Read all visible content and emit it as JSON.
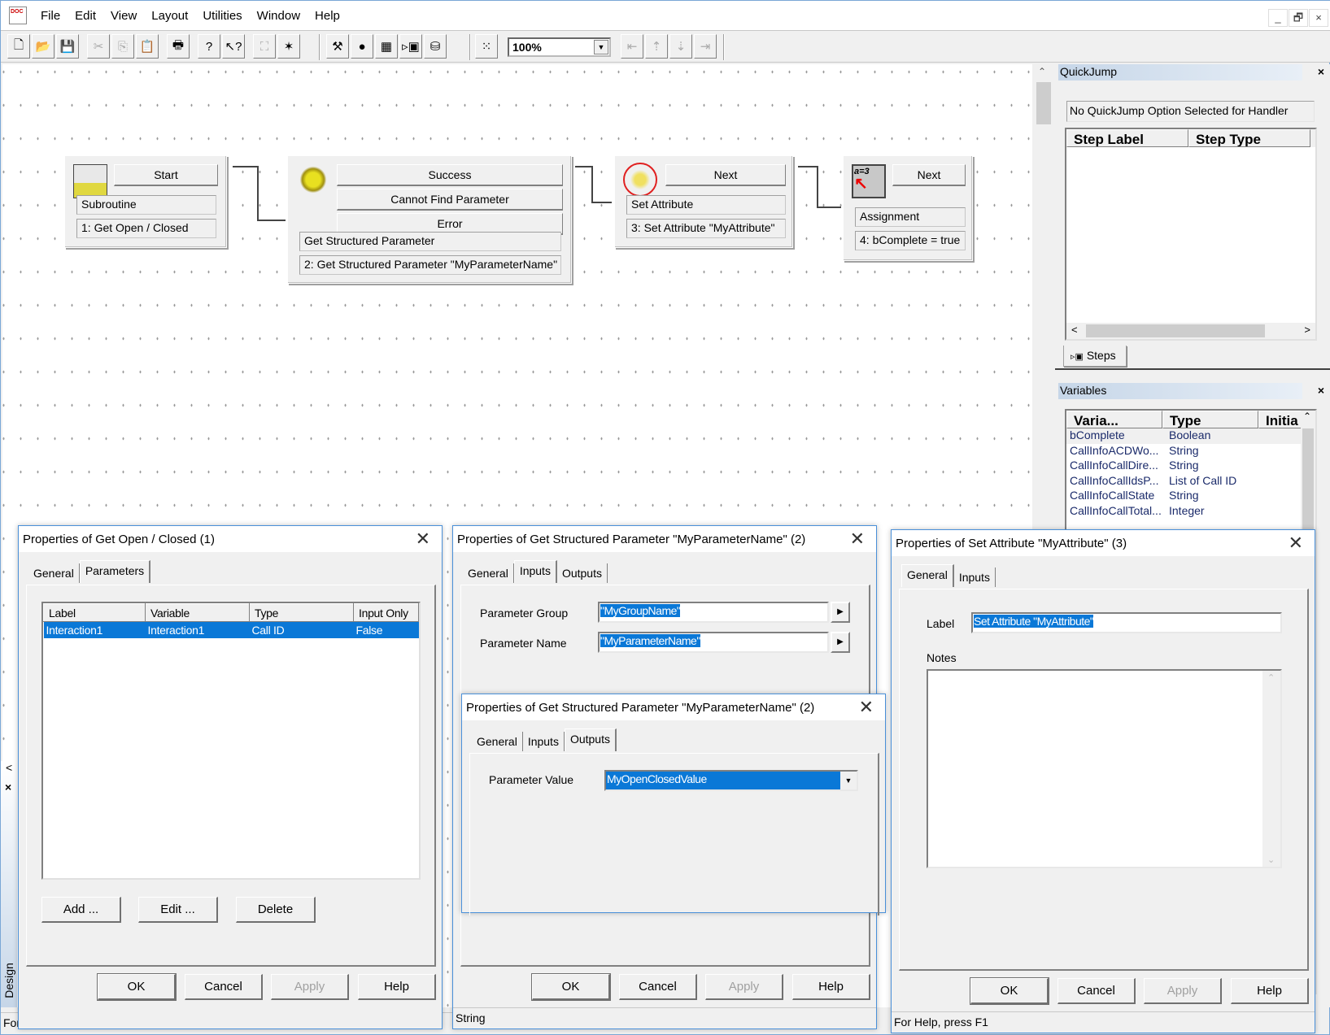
{
  "menu": [
    "File",
    "Edit",
    "View",
    "Layout",
    "Utilities",
    "Window",
    "Help"
  ],
  "window_controls": {
    "minimize": "_",
    "restore": "🗗",
    "close": "×"
  },
  "toolbar": {
    "buttons": [
      {
        "name": "new-icon",
        "glyph": "🗋"
      },
      {
        "name": "open-folder-icon",
        "glyph": "📂"
      },
      {
        "name": "save-icon",
        "glyph": "💾"
      },
      {
        "name": "cut-icon",
        "glyph": "✂"
      },
      {
        "name": "copy-icon",
        "glyph": "⎘"
      },
      {
        "name": "paste-icon",
        "glyph": "📋"
      },
      {
        "name": "print-icon",
        "glyph": "🖶"
      },
      {
        "name": "help-icon",
        "glyph": "?"
      },
      {
        "name": "context-help-icon",
        "glyph": "↖?"
      },
      {
        "name": "map-icon",
        "glyph": "⛶"
      },
      {
        "name": "debug-icon",
        "glyph": "✶"
      },
      {
        "name": "tools-icon",
        "glyph": "⚒"
      },
      {
        "name": "stop-icon",
        "glyph": "●"
      },
      {
        "name": "calculator-icon",
        "glyph": "▦"
      },
      {
        "name": "steps-panel-icon",
        "glyph": "▹▣"
      },
      {
        "name": "network-icon",
        "glyph": "⛁"
      },
      {
        "name": "grid-icon",
        "glyph": "⁙"
      }
    ],
    "zoom_value": "100%",
    "align_buttons": [
      "align-left-icon",
      "align-top-icon",
      "align-bottom-icon",
      "align-right-icon"
    ]
  },
  "canvas": {
    "nodes": [
      {
        "icon": "subroutine-icon",
        "exits": [
          "Start"
        ],
        "type": "Subroutine",
        "label": "1: Get Open / Closed"
      },
      {
        "icon": "gears-icon",
        "exits": [
          "Success",
          "Cannot Find Parameter",
          "Error"
        ],
        "type": "Get Structured Parameter",
        "label": "2: Get Structured Parameter \"MyParameterName\""
      },
      {
        "icon": "set-attribute-icon",
        "exits": [
          "Next"
        ],
        "type": "Set Attribute",
        "label": "3: Set Attribute \"MyAttribute\""
      },
      {
        "icon": "assignment-icon",
        "exits": [
          "Next"
        ],
        "type": "Assignment",
        "label": "4: bComplete = true"
      }
    ]
  },
  "quickjump": {
    "title": "QuickJump",
    "message": "No QuickJump Option Selected for Handler",
    "columns": [
      "Step Label",
      "Step Type"
    ],
    "tab": "Steps"
  },
  "variables": {
    "title": "Variables",
    "columns": [
      "Varia...",
      "Type",
      "Initia"
    ],
    "rows": [
      [
        "bComplete",
        "Boolean"
      ],
      [
        "CallInfoACDWo...",
        "String"
      ],
      [
        "CallInfoCallDire...",
        "String"
      ],
      [
        "CallInfoCallIdsP...",
        "List of Call ID"
      ],
      [
        "CallInfoCallState",
        "String"
      ],
      [
        "CallInfoCallTotal...",
        "Integer"
      ]
    ]
  },
  "left_panel": {
    "label": "Design",
    "close": "×",
    "scroll_left": "<"
  },
  "status_main": "For Help, press F1",
  "dialog1": {
    "title": "Properties of Get Open / Closed (1)",
    "tabs": [
      "General",
      "Parameters"
    ],
    "active_tab": "Parameters",
    "columns": [
      "Label",
      "Variable",
      "Type",
      "Input Only"
    ],
    "rows": [
      [
        "Interaction1",
        "Interaction1",
        "Call ID",
        "False"
      ]
    ],
    "add": "Add ...",
    "edit": "Edit ...",
    "delete": "Delete",
    "ok": "OK",
    "cancel": "Cancel",
    "apply": "Apply",
    "help": "Help"
  },
  "dialog2": {
    "title": "Properties of Get Structured Parameter \"MyParameterName\" (2)",
    "tabs": [
      "General",
      "Inputs",
      "Outputs"
    ],
    "active_tab": "Inputs",
    "group_label": "Parameter Group",
    "group_value": "\"MyGroupName\"",
    "name_label": "Parameter Name",
    "name_value": "\"MyParameterName\"",
    "ok": "OK",
    "cancel": "Cancel",
    "apply": "Apply",
    "help": "Help",
    "status": "String"
  },
  "dialog2b": {
    "title": "Properties of Get Structured Parameter \"MyParameterName\" (2)",
    "tabs": [
      "General",
      "Inputs",
      "Outputs"
    ],
    "active_tab": "Outputs",
    "value_label": "Parameter Value",
    "value": "MyOpenClosedValue"
  },
  "dialog3": {
    "title": "Properties of Set Attribute \"MyAttribute\" (3)",
    "tabs": [
      "General",
      "Inputs"
    ],
    "active_tab": "General",
    "label_label": "Label",
    "label_value": "Set Attribute \"MyAttribute\"",
    "notes_label": "Notes",
    "notes_value": "",
    "ok": "OK",
    "cancel": "Cancel",
    "apply": "Apply",
    "help": "Help",
    "status": "For Help, press F1"
  },
  "colors": {
    "selection": "#0a78d7",
    "dialog_border": "#4a90d9",
    "dock_title": "#c6d6e8",
    "variable_text": "#1a2a6a"
  }
}
